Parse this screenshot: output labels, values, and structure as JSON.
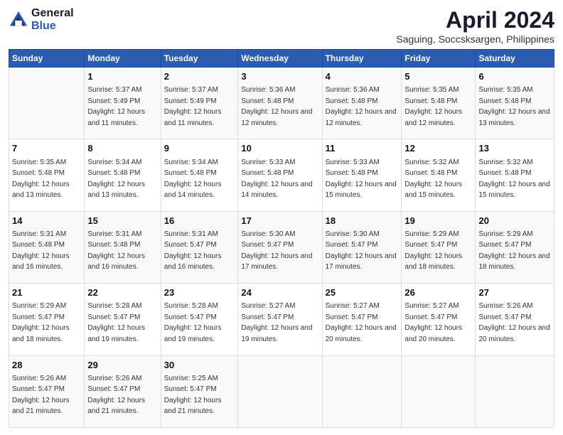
{
  "logo": {
    "general": "General",
    "blue": "Blue"
  },
  "title": "April 2024",
  "subtitle": "Saguing, Soccsksargen, Philippines",
  "days": [
    "Sunday",
    "Monday",
    "Tuesday",
    "Wednesday",
    "Thursday",
    "Friday",
    "Saturday"
  ],
  "weeks": [
    [
      {
        "num": "",
        "sunrise": "",
        "sunset": "",
        "daylight": ""
      },
      {
        "num": "1",
        "sunrise": "Sunrise: 5:37 AM",
        "sunset": "Sunset: 5:49 PM",
        "daylight": "Daylight: 12 hours and 11 minutes."
      },
      {
        "num": "2",
        "sunrise": "Sunrise: 5:37 AM",
        "sunset": "Sunset: 5:49 PM",
        "daylight": "Daylight: 12 hours and 11 minutes."
      },
      {
        "num": "3",
        "sunrise": "Sunrise: 5:36 AM",
        "sunset": "Sunset: 5:48 PM",
        "daylight": "Daylight: 12 hours and 12 minutes."
      },
      {
        "num": "4",
        "sunrise": "Sunrise: 5:36 AM",
        "sunset": "Sunset: 5:48 PM",
        "daylight": "Daylight: 12 hours and 12 minutes."
      },
      {
        "num": "5",
        "sunrise": "Sunrise: 5:35 AM",
        "sunset": "Sunset: 5:48 PM",
        "daylight": "Daylight: 12 hours and 12 minutes."
      },
      {
        "num": "6",
        "sunrise": "Sunrise: 5:35 AM",
        "sunset": "Sunset: 5:48 PM",
        "daylight": "Daylight: 12 hours and 13 minutes."
      }
    ],
    [
      {
        "num": "7",
        "sunrise": "Sunrise: 5:35 AM",
        "sunset": "Sunset: 5:48 PM",
        "daylight": "Daylight: 12 hours and 13 minutes."
      },
      {
        "num": "8",
        "sunrise": "Sunrise: 5:34 AM",
        "sunset": "Sunset: 5:48 PM",
        "daylight": "Daylight: 12 hours and 13 minutes."
      },
      {
        "num": "9",
        "sunrise": "Sunrise: 5:34 AM",
        "sunset": "Sunset: 5:48 PM",
        "daylight": "Daylight: 12 hours and 14 minutes."
      },
      {
        "num": "10",
        "sunrise": "Sunrise: 5:33 AM",
        "sunset": "Sunset: 5:48 PM",
        "daylight": "Daylight: 12 hours and 14 minutes."
      },
      {
        "num": "11",
        "sunrise": "Sunrise: 5:33 AM",
        "sunset": "Sunset: 5:48 PM",
        "daylight": "Daylight: 12 hours and 15 minutes."
      },
      {
        "num": "12",
        "sunrise": "Sunrise: 5:32 AM",
        "sunset": "Sunset: 5:48 PM",
        "daylight": "Daylight: 12 hours and 15 minutes."
      },
      {
        "num": "13",
        "sunrise": "Sunrise: 5:32 AM",
        "sunset": "Sunset: 5:48 PM",
        "daylight": "Daylight: 12 hours and 15 minutes."
      }
    ],
    [
      {
        "num": "14",
        "sunrise": "Sunrise: 5:31 AM",
        "sunset": "Sunset: 5:48 PM",
        "daylight": "Daylight: 12 hours and 16 minutes."
      },
      {
        "num": "15",
        "sunrise": "Sunrise: 5:31 AM",
        "sunset": "Sunset: 5:48 PM",
        "daylight": "Daylight: 12 hours and 16 minutes."
      },
      {
        "num": "16",
        "sunrise": "Sunrise: 5:31 AM",
        "sunset": "Sunset: 5:47 PM",
        "daylight": "Daylight: 12 hours and 16 minutes."
      },
      {
        "num": "17",
        "sunrise": "Sunrise: 5:30 AM",
        "sunset": "Sunset: 5:47 PM",
        "daylight": "Daylight: 12 hours and 17 minutes."
      },
      {
        "num": "18",
        "sunrise": "Sunrise: 5:30 AM",
        "sunset": "Sunset: 5:47 PM",
        "daylight": "Daylight: 12 hours and 17 minutes."
      },
      {
        "num": "19",
        "sunrise": "Sunrise: 5:29 AM",
        "sunset": "Sunset: 5:47 PM",
        "daylight": "Daylight: 12 hours and 18 minutes."
      },
      {
        "num": "20",
        "sunrise": "Sunrise: 5:29 AM",
        "sunset": "Sunset: 5:47 PM",
        "daylight": "Daylight: 12 hours and 18 minutes."
      }
    ],
    [
      {
        "num": "21",
        "sunrise": "Sunrise: 5:29 AM",
        "sunset": "Sunset: 5:47 PM",
        "daylight": "Daylight: 12 hours and 18 minutes."
      },
      {
        "num": "22",
        "sunrise": "Sunrise: 5:28 AM",
        "sunset": "Sunset: 5:47 PM",
        "daylight": "Daylight: 12 hours and 19 minutes."
      },
      {
        "num": "23",
        "sunrise": "Sunrise: 5:28 AM",
        "sunset": "Sunset: 5:47 PM",
        "daylight": "Daylight: 12 hours and 19 minutes."
      },
      {
        "num": "24",
        "sunrise": "Sunrise: 5:27 AM",
        "sunset": "Sunset: 5:47 PM",
        "daylight": "Daylight: 12 hours and 19 minutes."
      },
      {
        "num": "25",
        "sunrise": "Sunrise: 5:27 AM",
        "sunset": "Sunset: 5:47 PM",
        "daylight": "Daylight: 12 hours and 20 minutes."
      },
      {
        "num": "26",
        "sunrise": "Sunrise: 5:27 AM",
        "sunset": "Sunset: 5:47 PM",
        "daylight": "Daylight: 12 hours and 20 minutes."
      },
      {
        "num": "27",
        "sunrise": "Sunrise: 5:26 AM",
        "sunset": "Sunset: 5:47 PM",
        "daylight": "Daylight: 12 hours and 20 minutes."
      }
    ],
    [
      {
        "num": "28",
        "sunrise": "Sunrise: 5:26 AM",
        "sunset": "Sunset: 5:47 PM",
        "daylight": "Daylight: 12 hours and 21 minutes."
      },
      {
        "num": "29",
        "sunrise": "Sunrise: 5:26 AM",
        "sunset": "Sunset: 5:47 PM",
        "daylight": "Daylight: 12 hours and 21 minutes."
      },
      {
        "num": "30",
        "sunrise": "Sunrise: 5:25 AM",
        "sunset": "Sunset: 5:47 PM",
        "daylight": "Daylight: 12 hours and 21 minutes."
      },
      {
        "num": "",
        "sunrise": "",
        "sunset": "",
        "daylight": ""
      },
      {
        "num": "",
        "sunrise": "",
        "sunset": "",
        "daylight": ""
      },
      {
        "num": "",
        "sunrise": "",
        "sunset": "",
        "daylight": ""
      },
      {
        "num": "",
        "sunrise": "",
        "sunset": "",
        "daylight": ""
      }
    ]
  ]
}
